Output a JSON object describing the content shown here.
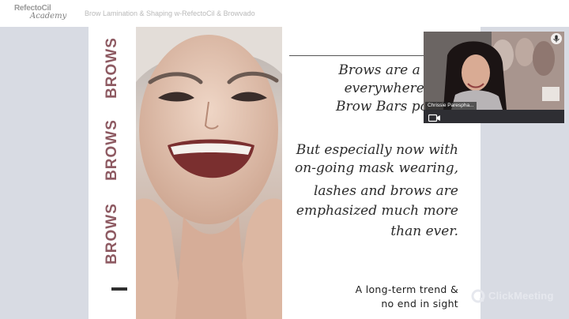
{
  "header": {
    "logo_main": "RefectoCil",
    "logo_sub": "Academy",
    "meeting_title": "Brow Lamination & Shaping w-RefectoCil & Browvado"
  },
  "slide": {
    "vertical_words": [
      "BROWS",
      "BROWS",
      "BROWS"
    ],
    "accent_color": "#8e5a62",
    "italic_lines": [
      "Brows are a huge",
      "everywhere with",
      "Brow Bars poppin",
      "But especially now with",
      "on-going mask wearing,",
      "lashes and brows are",
      "emphasized much more",
      "than ever."
    ],
    "tagline_lines": [
      "A long-term trend &",
      "no end in sight"
    ]
  },
  "video": {
    "presenter_name": "Chrissie Parespha...",
    "camera_icon": "camera-icon",
    "mic_icon": "microphone-icon"
  },
  "watermark": {
    "text": "ClickMeeting",
    "icon": "clickmeeting-logo-icon"
  }
}
